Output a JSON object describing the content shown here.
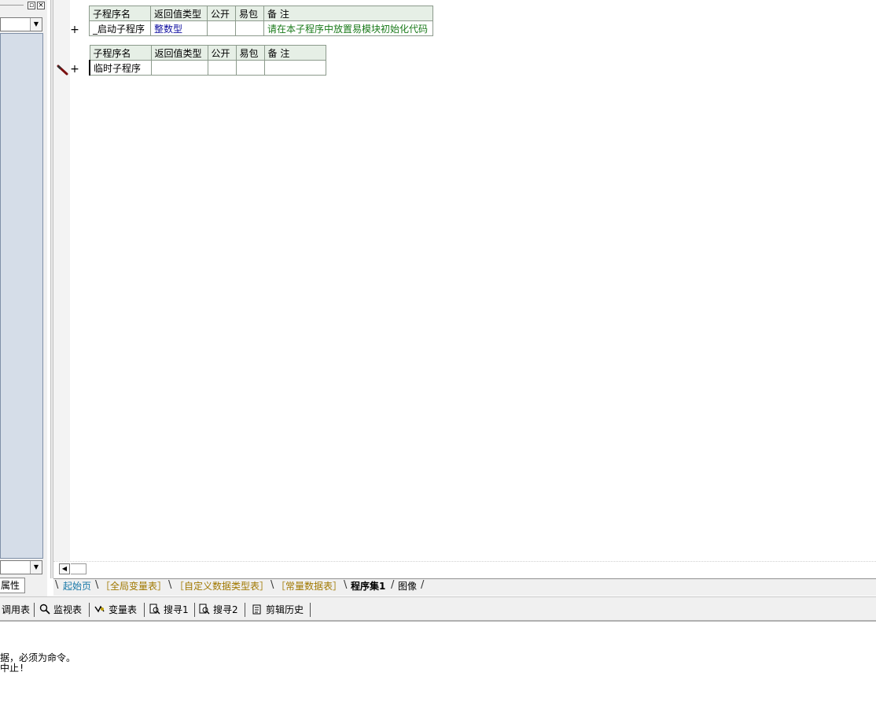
{
  "left_panel": {
    "property_tab": "属性"
  },
  "tables": [
    {
      "headers": [
        "子程序名",
        "返回值类型",
        "公开",
        "易包",
        "备 注"
      ],
      "row": {
        "name": "_启动子程序",
        "return_type": "整数型",
        "public": "",
        "easy_pkg": "",
        "remark": "请在本子程序中放置易模块初始化代码"
      }
    },
    {
      "headers": [
        "子程序名",
        "返回值类型",
        "公开",
        "易包",
        "备 注"
      ],
      "row": {
        "name": "临时子程序",
        "return_type": "",
        "public": "",
        "easy_pkg": "",
        "remark": ""
      }
    }
  ],
  "gutter": {
    "plus": "+"
  },
  "tabs": [
    "起始页",
    "［全局变量表］",
    "［自定义数据类型表］",
    "［常量数据表］",
    "程序集1",
    "图像"
  ],
  "bottom_tools": [
    "调用表",
    "监视表",
    "变量表",
    "搜寻1",
    "搜寻2",
    "剪辑历史"
  ],
  "output": {
    "line1": "据，必须为命令。",
    "line2": "中止!"
  },
  "colors": {
    "list_bg": "#d5dde8",
    "header_bg": "#e6efe6",
    "type_blue": "#1010a0",
    "remark_green": "#1a7a1a",
    "tab_blue": "#1878a8",
    "tab_olive": "#a07800"
  }
}
